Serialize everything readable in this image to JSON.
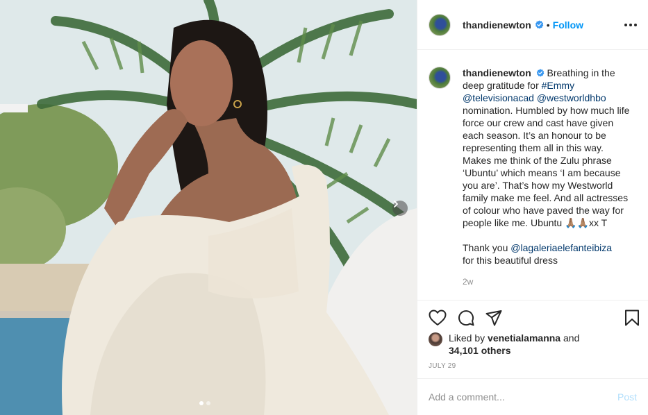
{
  "post": {
    "author": "thandienewton",
    "follow_label": "Follow",
    "bullet": "•",
    "caption": {
      "author": "thandienewton",
      "text_1": " Breathing in the deep gratitude for ",
      "hashtag_emmy": "#Emmy",
      "mention_tvacad": "@televisionacad",
      "mention_westworld": "@westworldhbo",
      "text_2": " nomination. Humbled by how much life force our crew and cast have given each season. It’s an honour to be representing them all in this way. Makes me think of the Zulu phrase ‘Ubuntu’ which means ‘I am because you are’. That’s how my Westworld family make me feel. And all actresses of colour who have paved the way for people like me. Ubuntu ",
      "emoji": "🙏🏽🙏🏽",
      "text_3": "xx T",
      "thank_you": "Thank you ",
      "mention_dress": "@lagaleriaelefanteibiza",
      "text_4": "for this beautiful dress",
      "time_ago": "2w"
    },
    "likes": {
      "liked_by": "Liked by ",
      "liker": "venetialamanna",
      "and": " and",
      "others": "34,101 others"
    },
    "date": "JULY 29",
    "comment": {
      "placeholder": "Add a comment...",
      "post_label": "Post"
    },
    "carousel": {
      "dots": 2,
      "active_index": 0
    }
  },
  "colors": {
    "accent": "#0095f6",
    "link": "#00376b",
    "muted": "#8e8e8e",
    "post_disabled": "#b2dffc",
    "verified": "#3897f0"
  },
  "icons": [
    "verified-badge-icon",
    "more-options-icon",
    "heart-icon",
    "comment-icon",
    "share-icon",
    "bookmark-icon",
    "chevron-right-icon"
  ]
}
